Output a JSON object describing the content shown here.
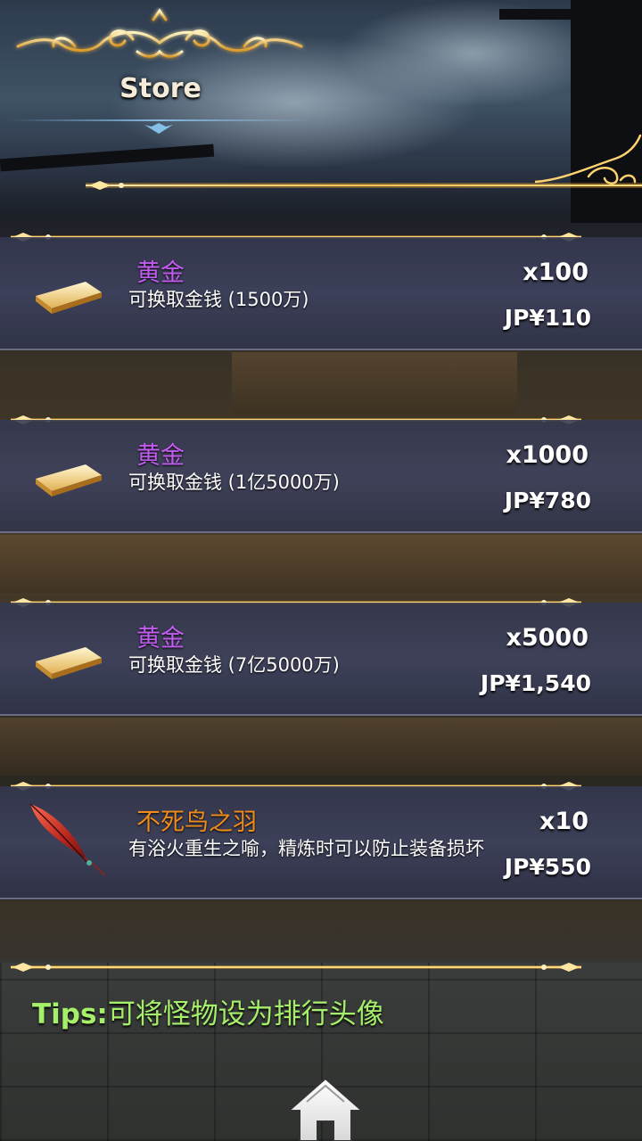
{
  "header": {
    "title": "Store"
  },
  "items": [
    {
      "name": "黄金",
      "name_color": "#c25cf0",
      "description": "可换取金钱 (1500万)",
      "quantity": "x100",
      "price": "JP¥110",
      "icon": "gold-bar-icon"
    },
    {
      "name": "黄金",
      "name_color": "#c25cf0",
      "description": "可换取金钱 (1亿5000万)",
      "quantity": "x1000",
      "price": "JP¥780",
      "icon": "gold-bar-icon"
    },
    {
      "name": "黄金",
      "name_color": "#c25cf0",
      "description": "可换取金钱 (7亿5000万)",
      "quantity": "x5000",
      "price": "JP¥1,540",
      "icon": "gold-bar-icon"
    },
    {
      "name": "不死鸟之羽",
      "name_color": "#f08c1c",
      "description": "有浴火重生之喻，精炼时可以防止装备损坏",
      "quantity": "x10",
      "price": "JP¥550",
      "icon": "phoenix-feather-icon"
    }
  ],
  "tips": {
    "label": "Tips:",
    "text": "可将怪物设为排行头像"
  },
  "navigation": {
    "home_icon": "home-icon"
  },
  "colors": {
    "accent_gold": "#ffcc55",
    "tips_green": "#a6ef6a",
    "item_name_purple": "#c25cf0",
    "item_name_orange": "#f08c1c"
  }
}
